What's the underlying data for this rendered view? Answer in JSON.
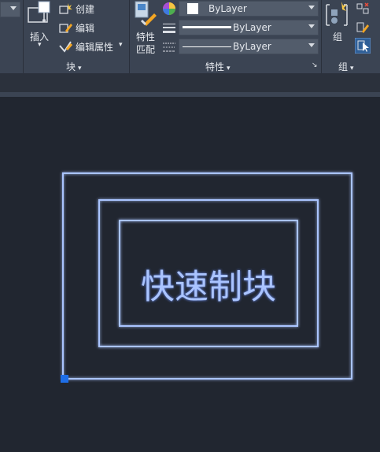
{
  "ribbon": {
    "block_group": {
      "insert_label": "插入",
      "create_label": "创建",
      "edit_label": "编辑",
      "edit_attr_label": "编辑属性",
      "group_title": "块"
    },
    "properties_group": {
      "match_label_line1": "特性",
      "match_label_line2": "匹配",
      "color_value": "ByLayer",
      "lineweight_value": "ByLayer",
      "linetype_value": "ByLayer",
      "group_title": "特性"
    },
    "group_group": {
      "group_label": "组",
      "group_title": "组"
    }
  },
  "drawing": {
    "text": "快速制块",
    "line_color": "#aac4ff",
    "grip_color": "#1e6ee8"
  }
}
